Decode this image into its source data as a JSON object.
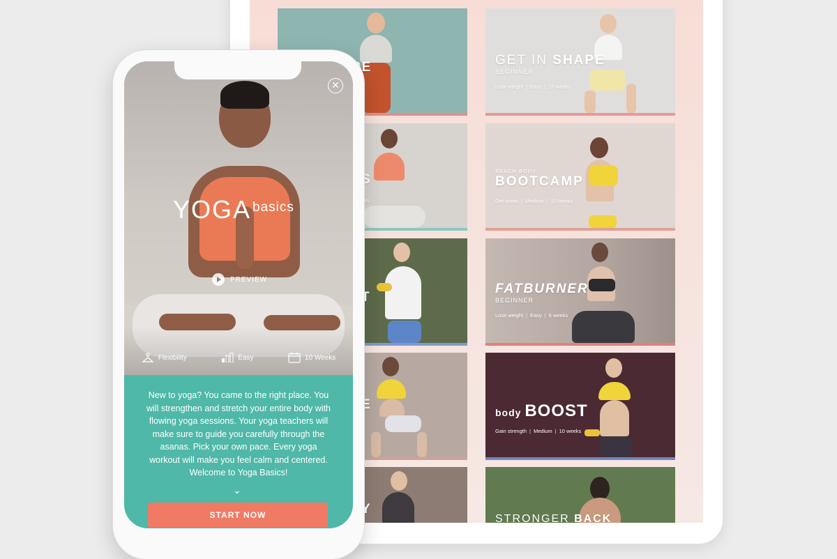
{
  "tablet": {
    "cards": [
      {
        "id": "shape-partial",
        "title": "",
        "title_bold": "PE",
        "subtitle": "",
        "meta": [],
        "bg": "#8fb5b1"
      },
      {
        "id": "get-in-shape",
        "title": "GET IN ",
        "title_bold": "SHAPE",
        "subtitle": "BEGINNER",
        "meta": [
          "Lose weight",
          "Easy",
          "10 weeks"
        ],
        "bg": "#e0dedd"
      },
      {
        "id": "yoga-partial",
        "title": "",
        "title_bold": "S",
        "subtitle": "",
        "meta": [
          "eks"
        ],
        "bg": "#d7d3cf"
      },
      {
        "id": "bootcamp",
        "eyebrow": "BEACH BODY",
        "title": "BOOTCAMP",
        "title_bold": "",
        "subtitle": "",
        "meta": [
          "Get toned",
          "Medium",
          "10 weeks"
        ],
        "bg": "#e0d7d3"
      },
      {
        "id": "weights-partial",
        "title": "",
        "title_bold": "T",
        "subtitle": "",
        "meta": [],
        "bg": "#5d6b4a"
      },
      {
        "id": "fatburner",
        "title": "",
        "title_bold": "FATBURNER",
        "subtitle": "BEGINNER",
        "meta": [
          "Lose weight",
          "Easy",
          "6 weeks"
        ],
        "bg": "#b7aaa3"
      },
      {
        "id": "squat-partial",
        "title": "",
        "title_bold": "E",
        "subtitle": "",
        "meta": [],
        "bg": "#b7a9a2"
      },
      {
        "id": "body-boost",
        "title": "body ",
        "title_bold": "BOOST",
        "subtitle": "",
        "meta": [
          "Gain strength",
          "Medium",
          "10 weeks"
        ],
        "bg": "#4c2a33"
      },
      {
        "id": "partial-5",
        "title": "",
        "title_bold": "Y",
        "subtitle": "",
        "meta": [],
        "bg": "#8d7c74"
      },
      {
        "id": "stronger-back",
        "title": "STRONGER ",
        "title_bold": "BACK",
        "subtitle": "",
        "meta": [],
        "bg": "#627a4f"
      }
    ]
  },
  "phone": {
    "title_main": "YOGA",
    "title_small": "basics",
    "preview_label": "PREVIEW",
    "stats": {
      "focus": "Flexibility",
      "level": "Easy",
      "duration": "10 Weeks"
    },
    "description": "New to yoga? You came to the right place. You will strengthen and stretch your entire body with flowing yoga sessions. Your yoga teachers will make sure to guide you carefully through the asanas. Pick your own pace. Every yoga workout will make you feel calm and centered. Welcome to Yoga Basics!",
    "start_label": "START NOW",
    "close_symbol": "✕"
  },
  "colors": {
    "teal": "#4fb8a8",
    "coral": "#f07a63"
  }
}
